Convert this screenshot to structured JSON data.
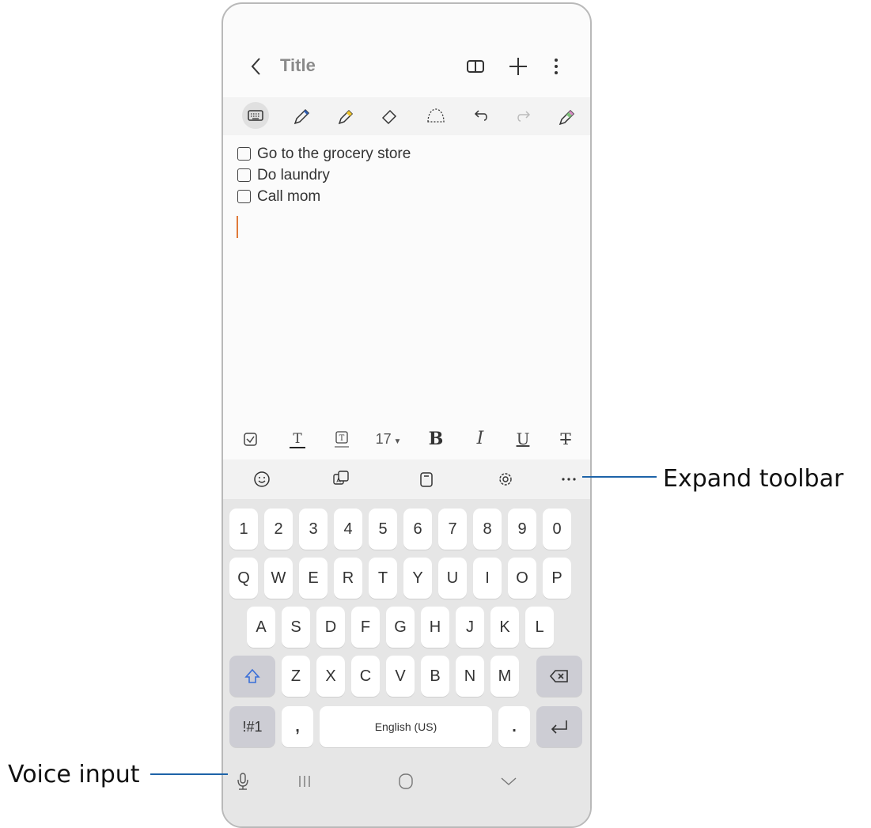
{
  "header": {
    "title": "Title"
  },
  "checklist": [
    {
      "label": "Go to the grocery store"
    },
    {
      "label": "Do laundry"
    },
    {
      "label": "Call mom"
    }
  ],
  "format_bar": {
    "font_size": "17"
  },
  "keyboard": {
    "row_numbers": [
      "1",
      "2",
      "3",
      "4",
      "5",
      "6",
      "7",
      "8",
      "9",
      "0"
    ],
    "row_q": [
      "Q",
      "W",
      "E",
      "R",
      "T",
      "Y",
      "U",
      "I",
      "O",
      "P"
    ],
    "row_a": [
      "A",
      "S",
      "D",
      "F",
      "G",
      "H",
      "J",
      "K",
      "L"
    ],
    "row_z": [
      "Z",
      "X",
      "C",
      "V",
      "B",
      "N",
      "M"
    ],
    "symbols_label": "!#1",
    "comma_label": ",",
    "space_label": "English (US)",
    "period_label": "."
  },
  "callouts": {
    "expand_toolbar": "Expand toolbar",
    "voice_input": "Voice input"
  },
  "colors": {
    "callout_line": "#1d63a8",
    "cursor": "#e07a3a",
    "shift_arrow": "#3a6fd8"
  }
}
